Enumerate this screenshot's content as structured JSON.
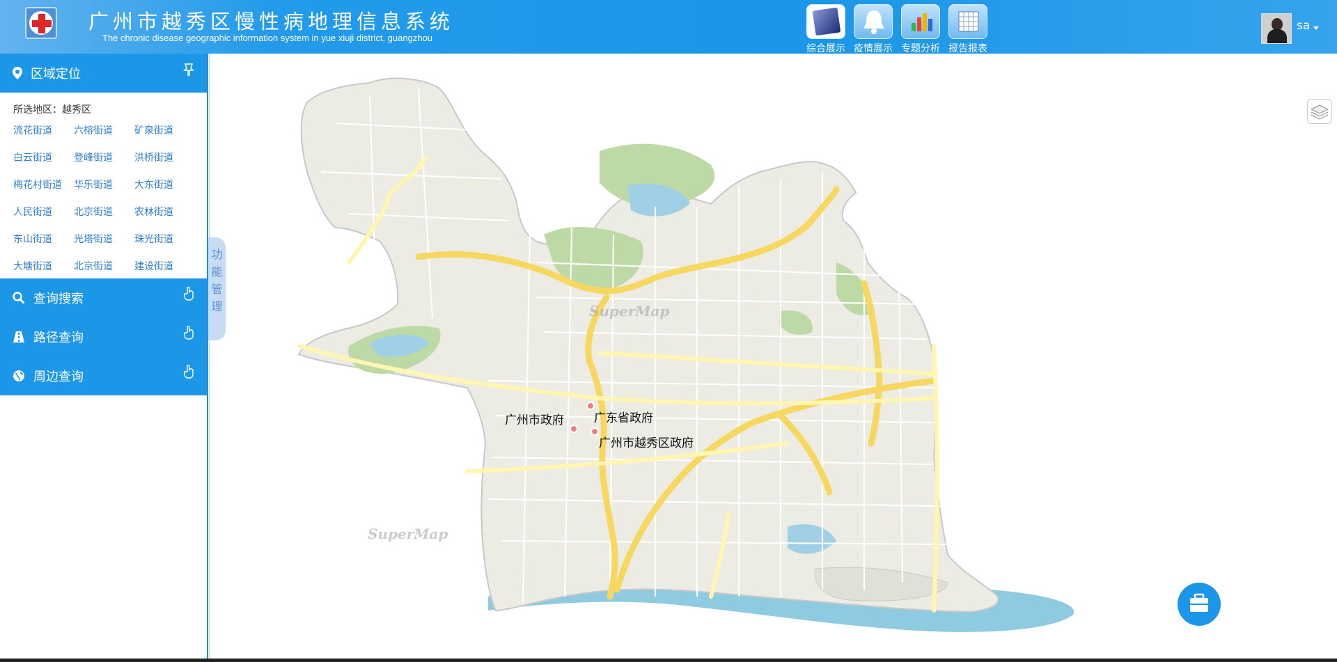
{
  "header": {
    "title_cn": "广州市越秀区慢性病地理信息系统",
    "title_en": "The chronic disease geographic information system in yue xiuji district, guangzhou",
    "nav": [
      {
        "label": "综合展示",
        "icon": "monitor-icon",
        "active": true
      },
      {
        "label": "疫情展示",
        "icon": "bell-icon",
        "active": false
      },
      {
        "label": "专题分析",
        "icon": "bar-chart-icon",
        "active": false
      },
      {
        "label": "报告报表",
        "icon": "table-icon",
        "active": false
      }
    ],
    "user": "sa"
  },
  "sidebar": {
    "region": {
      "title": "区域定位",
      "selected_prefix": "所选地区：",
      "selected_value": "越秀区",
      "streets": [
        "流花街道",
        "六榕街道",
        "矿泉街道",
        "白云街道",
        "登峰街道",
        "洪桥街道",
        "梅花村街道",
        "华乐街道",
        "大东街道",
        "人民街道",
        "北京街道",
        "农林街道",
        "东山街道",
        "光塔街道",
        "珠光街道",
        "大塘街道",
        "北京街道",
        "建设街道"
      ]
    },
    "panels": [
      {
        "title": "查询搜索",
        "icon": "search-icon"
      },
      {
        "title": "路径查询",
        "icon": "road-icon"
      },
      {
        "title": "周边查询",
        "icon": "globe-icon"
      }
    ],
    "function_tab": "功能管理"
  },
  "map": {
    "pois": [
      {
        "label": "广州市政府"
      },
      {
        "label": "广东省政府"
      },
      {
        "label": "广州市越秀区政府"
      }
    ],
    "watermark": "SuperMap"
  }
}
